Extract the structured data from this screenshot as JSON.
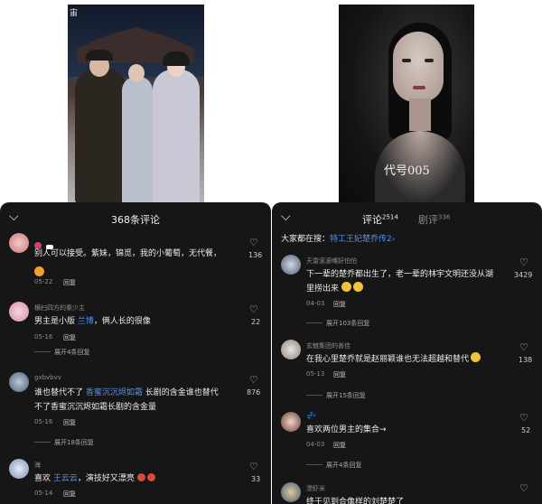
{
  "left_photo": {
    "title_glyph": "宙"
  },
  "right_photo": {
    "watermark": "代号005"
  },
  "left_panel": {
    "header": "368条评论",
    "comments": [
      {
        "user": "",
        "text_line1": "别人可以接受。紫妹，锦觅，我的小葡萄，无代餐，",
        "date": "05-22",
        "reply": "回复",
        "likes": "136"
      },
      {
        "user": "横扫四方的秦少主",
        "text_pre": "男主是小版 ",
        "mention": "兰博",
        "text_post": "，俩人长的很像",
        "date": "05-16",
        "reply": "回复",
        "expand": "展开4条回复",
        "likes": "22"
      },
      {
        "user": "gxbvbvv",
        "text_pre": "谁也替代不了 ",
        "mention": "香蜜沉沉烬如霜",
        "text_post": " 长剧的含金谁也替代",
        "text_line2": "不了香蜜沉沉烬如霜长剧的含金量",
        "date": "05-16",
        "reply": "回复",
        "expand": "展开18条回复",
        "likes": "876"
      },
      {
        "user": "海",
        "text_pre": "喜欢 ",
        "mention": "王云云",
        "text_post": "，演技好又漂亮",
        "date": "05-14",
        "reply": "回复",
        "likes": "33"
      }
    ]
  },
  "right_panel": {
    "tab_comments": "评论",
    "tab_comments_count": "2514",
    "tab_reviews": "剧评",
    "tab_reviews_count": "336",
    "search_prefix": "大家都在搜：",
    "search_term": "特工王妃楚乔传2",
    "comments": [
      {
        "user": "天雷滚滚嘴好怕怕",
        "text_line1": "下一辈的楚乔都出生了，老一辈的林宇文明还没从湖",
        "text_line2": "里捞出来",
        "date": "04-03",
        "reply": "回复",
        "expand": "展开103条回复",
        "likes": "3429"
      },
      {
        "user": "玄魅集团的善佳",
        "text_line1": "在我心里楚乔就是赵丽颖谁也无法超越和替代",
        "date": "05-13",
        "reply": "回复",
        "expand": "展开15条回复",
        "likes": "138"
      },
      {
        "user": "",
        "text_line1": "喜欢两位男主的集合→",
        "date": "04-03",
        "reply": "回复",
        "expand": "展开4条回复",
        "likes": "52"
      },
      {
        "user": "漂虾米",
        "text_line1": "终于见到合像样的刘楚楚了",
        "likes": ""
      }
    ]
  },
  "colors": {
    "panel_bg": "#161616",
    "mention": "#5b8ee8",
    "muted": "#8e8e8e"
  }
}
